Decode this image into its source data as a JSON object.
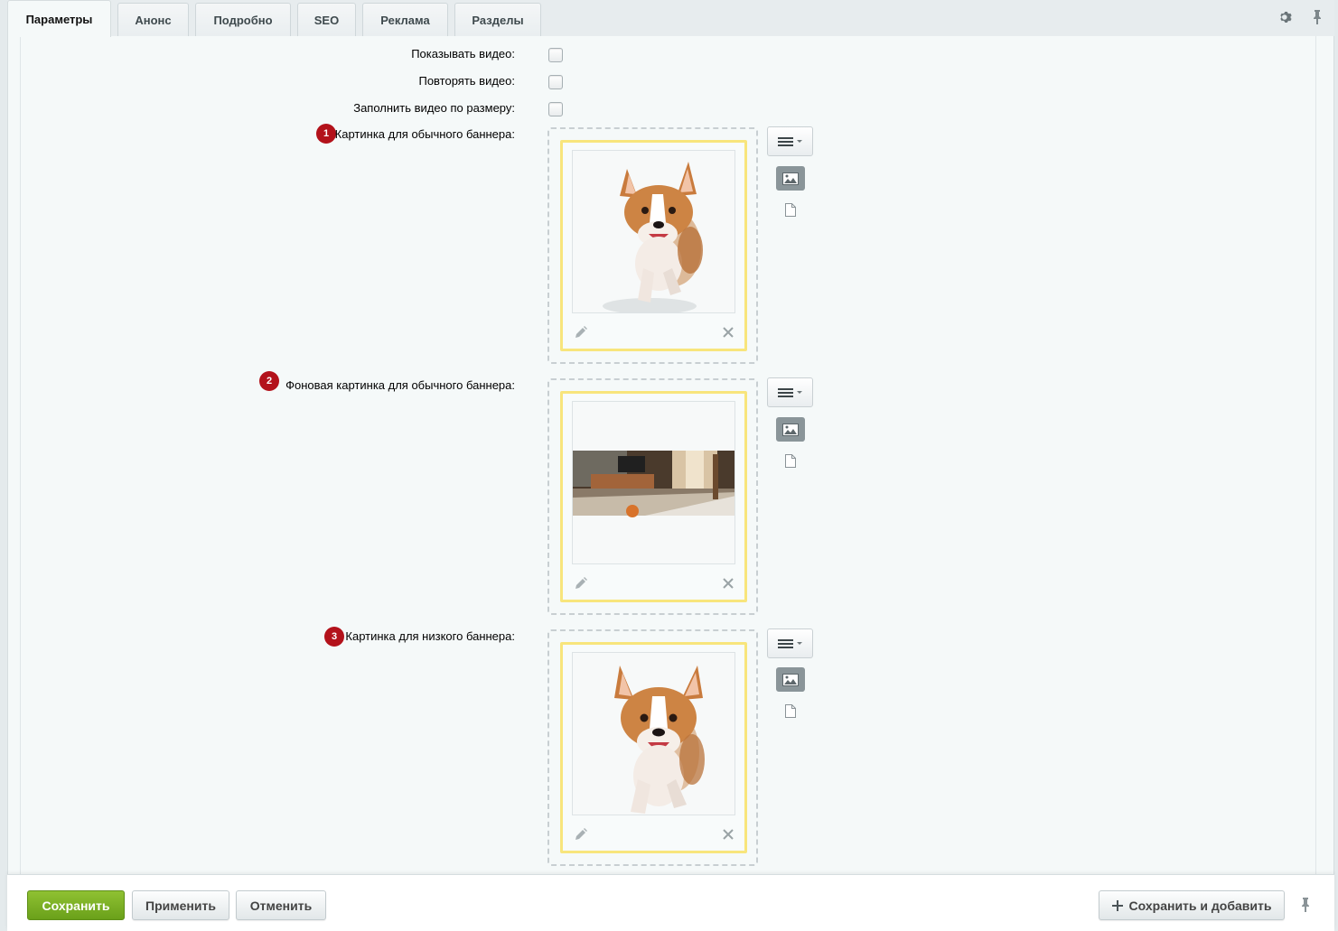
{
  "tabs": [
    {
      "label": "Параметры",
      "active": true
    },
    {
      "label": "Анонс"
    },
    {
      "label": "Подробно"
    },
    {
      "label": "SEO"
    },
    {
      "label": "Реклама"
    },
    {
      "label": "Разделы"
    }
  ],
  "icons": {
    "settings": "gear-icon",
    "pin": "pin-icon"
  },
  "options": {
    "show_video": "Показывать видео:",
    "repeat_video": "Повторять видео:",
    "fill_video": "Заполнить видео по размеру:"
  },
  "images": [
    {
      "badge": "1",
      "label": "Картинка для обычного баннера:",
      "preview": "corgi-running"
    },
    {
      "badge": "2",
      "label": "Фоновая картинка для обычного баннера:",
      "preview": "living-room-interior"
    },
    {
      "badge": "3",
      "label": "Картинка для низкого баннера:",
      "preview": "corgi-closeup"
    }
  ],
  "footer": {
    "save": "Сохранить",
    "apply": "Применить",
    "cancel": "Отменить",
    "save_add": "Сохранить и добавить"
  },
  "colors": {
    "accent_green": "#7ab024",
    "badge_red": "#b3121b",
    "card_border": "#f8e57c"
  }
}
